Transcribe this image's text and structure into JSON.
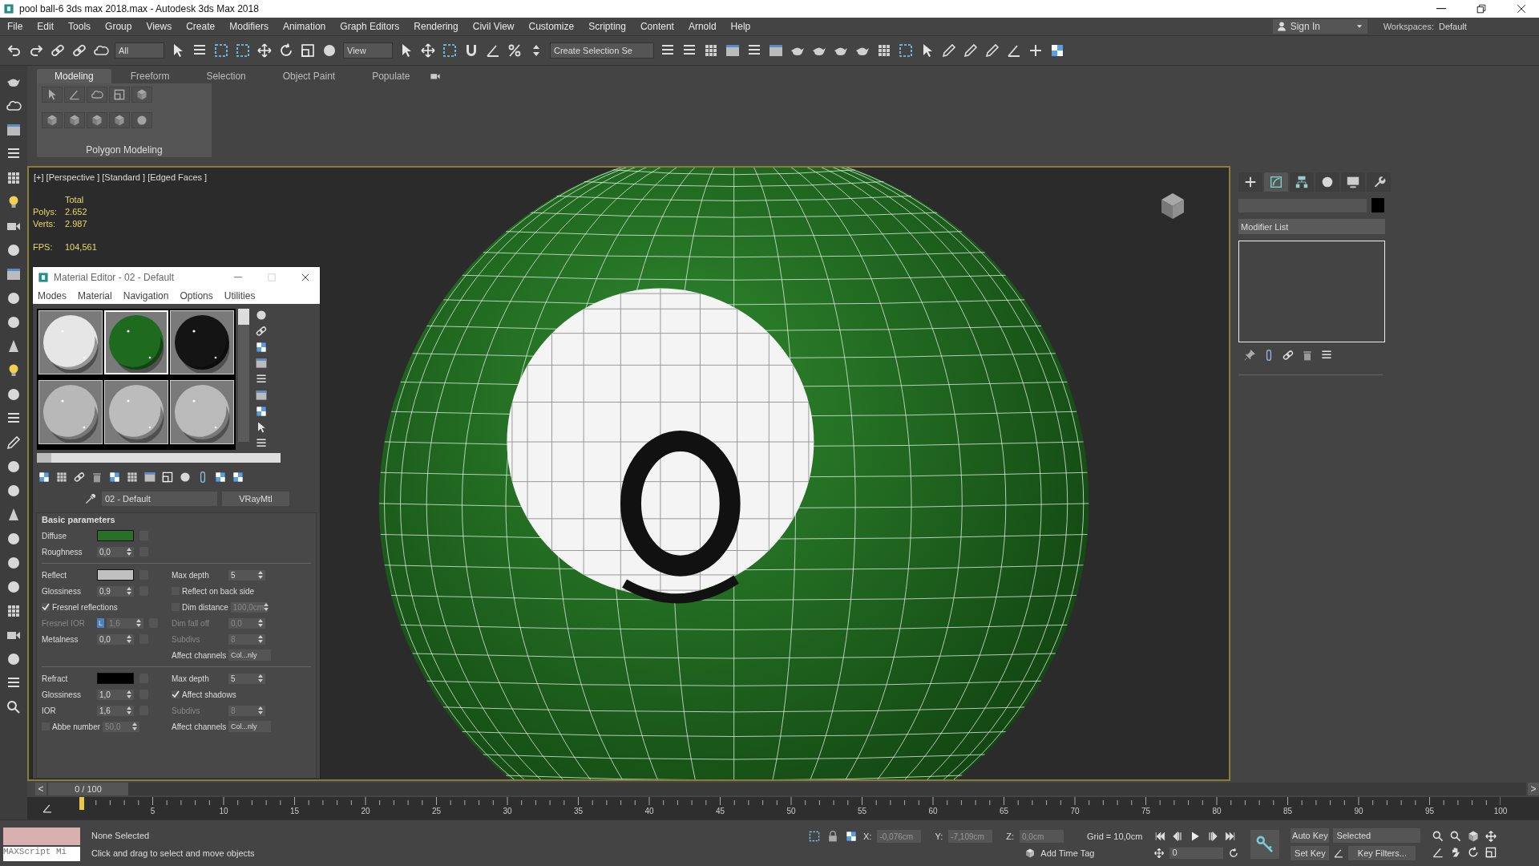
{
  "window": {
    "title": "pool ball-6 3ds max 2018.max - Autodesk 3ds Max 2018"
  },
  "menu": [
    "File",
    "Edit",
    "Tools",
    "Group",
    "Views",
    "Create",
    "Modifiers",
    "Animation",
    "Graph Editors",
    "Rendering",
    "Civil View",
    "Customize",
    "Scripting",
    "Content",
    "Arnold",
    "Help"
  ],
  "account": {
    "label": "Sign In"
  },
  "workspaces": {
    "label": "Workspaces:",
    "value": "Default"
  },
  "toolbar": {
    "filter": "All",
    "coordinate_system": "View",
    "selection_set": "Create Selection Se"
  },
  "ribbon": {
    "tabs": [
      {
        "label": "Modeling",
        "selected": true
      },
      {
        "label": "Freeform",
        "selected": false
      },
      {
        "label": "Selection",
        "selected": false
      },
      {
        "label": "Object Paint",
        "selected": false
      },
      {
        "label": "Populate",
        "selected": false
      }
    ],
    "panel": "Polygon Modeling"
  },
  "viewport": {
    "label": "[+] [Perspective ] [Standard ] [Edged Faces ]",
    "stats_header": "Total",
    "stats": [
      {
        "label": "Polys:",
        "value": "2.652"
      },
      {
        "label": "Verts:",
        "value": "2.987"
      },
      {
        "label": "FPS:",
        "value": "104,561"
      }
    ]
  },
  "material_editor": {
    "title": "Material Editor - 02 - Default",
    "menu": [
      "Modes",
      "Material",
      "Navigation",
      "Options",
      "Utilities"
    ],
    "slots": [
      {
        "color": "#e6e6e6",
        "selected": false
      },
      {
        "color": "#1e6a1e",
        "selected": true
      },
      {
        "color": "#141414",
        "selected": false
      },
      {
        "color": "#b8b8b8",
        "selected": false
      },
      {
        "color": "#bcbcbc",
        "selected": false
      },
      {
        "color": "#bababa",
        "selected": false
      }
    ],
    "material_name": "02 - Default",
    "material_type": "VRayMtl",
    "rollout": "Basic parameters",
    "groups": [
      [
        {
          "left": {
            "kind": "swatch",
            "label": "Diffuse",
            "color": "#2a6e2a"
          }
        },
        {
          "left": {
            "kind": "spinner",
            "label": "Roughness",
            "value": "0,0",
            "disabled": false
          }
        }
      ],
      [
        {
          "left": {
            "kind": "swatch",
            "label": "Reflect",
            "color": "#c0c0c0"
          },
          "right": {
            "kind": "spinner",
            "label": "Max depth",
            "value": "5",
            "disabled": false
          }
        },
        {
          "left": {
            "kind": "spinner",
            "label": "Glossiness",
            "value": "0,9",
            "disabled": false
          },
          "right": {
            "kind": "checkbox",
            "label": "Reflect on back side",
            "checked": false
          }
        },
        {
          "left": {
            "kind": "checkbox",
            "label": "Fresnel reflections",
            "checked": true
          },
          "right": {
            "kind": "checkbox",
            "label": "Dim distance",
            "checked": false,
            "value": "100,0cm"
          }
        },
        {
          "left": {
            "kind": "spinner",
            "label": "Fresnel IOR",
            "value": "1,6",
            "disabled": true,
            "lock": "L"
          },
          "right": {
            "kind": "spinner",
            "label": "Dim fall off",
            "value": "0,0",
            "disabled": true
          }
        },
        {
          "left": {
            "kind": "spinner",
            "label": "Metalness",
            "value": "0,0",
            "disabled": false
          },
          "right": {
            "kind": "spinner",
            "label": "Subdivs",
            "value": "8",
            "disabled": true
          }
        },
        {
          "right": {
            "kind": "dropdown",
            "label": "Affect channels",
            "value": "Col...nly"
          }
        }
      ],
      [
        {
          "left": {
            "kind": "swatch",
            "label": "Refract",
            "color": "#000000"
          },
          "right": {
            "kind": "spinner",
            "label": "Max depth",
            "value": "5",
            "disabled": false
          }
        },
        {
          "left": {
            "kind": "spinner",
            "label": "Glossiness",
            "value": "1,0",
            "disabled": false
          },
          "right": {
            "kind": "checkbox",
            "label": "Affect shadows",
            "checked": true
          }
        },
        {
          "left": {
            "kind": "spinner",
            "label": "IOR",
            "value": "1,6",
            "disabled": false
          },
          "right": {
            "kind": "spinner",
            "label": "Subdivs",
            "value": "8",
            "disabled": true
          }
        },
        {
          "left": {
            "kind": "checkbox",
            "label": "Abbe number",
            "checked": false,
            "value": "50,0"
          },
          "right": {
            "kind": "dropdown",
            "label": "Affect channels",
            "value": "Col...nly"
          }
        }
      ]
    ]
  },
  "command_tabs": [
    {
      "selected": false
    },
    {
      "selected": true
    },
    {
      "selected": false
    },
    {
      "selected": false
    },
    {
      "selected": false
    },
    {
      "selected": false
    }
  ],
  "modifier_panel": {
    "placeholder": "Modifier List"
  },
  "time_slider": {
    "prev": "<",
    "position": "0 / 100",
    "next": ">"
  },
  "timeline": {
    "ticks": [
      "5",
      "10",
      "15",
      "20",
      "25",
      "30",
      "35",
      "40",
      "45",
      "50",
      "55",
      "60",
      "65",
      "70",
      "75",
      "80",
      "85",
      "90",
      "95",
      "100"
    ]
  },
  "status": {
    "listener": "MAXScript Mi",
    "selection": "None Selected",
    "prompt": "Click and drag to select and move objects",
    "x_label": "X:",
    "x": "-0,076cm",
    "y_label": "Y:",
    "y": "-7,109cm",
    "z_label": "Z:",
    "z": "0,0cm",
    "grid": "Grid = 10,0cm",
    "time_tag": "Add Time Tag",
    "frame": "0",
    "auto_key": "Auto Key",
    "key_mode": "Selected",
    "set_key": "Set Key",
    "key_filters": "Key Filters..."
  }
}
